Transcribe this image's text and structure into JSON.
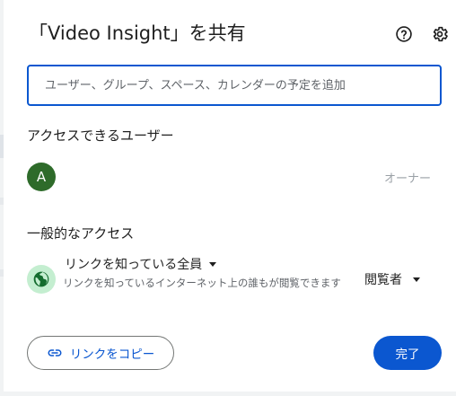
{
  "dialog": {
    "title": "「Video Insight」を共有",
    "help_icon": "help-circle-icon",
    "settings_icon": "gear-icon"
  },
  "share_input": {
    "placeholder": "ユーザー、グループ、スペース、カレンダーの予定を追加",
    "value": ""
  },
  "people_section": {
    "title": "アクセスできるユーザー",
    "users": [
      {
        "avatar_letter": "A",
        "avatar_color": "#2e6b2a",
        "role": "オーナー"
      }
    ]
  },
  "general_access": {
    "title": "一般的なアクセス",
    "icon": "globe-icon",
    "icon_bg_color": "#c4eed0",
    "selected_option": "リンクを知っている全員",
    "description": "リンクを知っているインターネット上の誰もが閲覧できます",
    "role": "閲覧者"
  },
  "footer": {
    "copy_link_label": "リンクをコピー",
    "copy_link_icon": "link-icon",
    "done_label": "完了"
  },
  "colors": {
    "accent": "#0b57d0",
    "text_primary": "#1f1f1f",
    "text_secondary": "#5f6368"
  }
}
